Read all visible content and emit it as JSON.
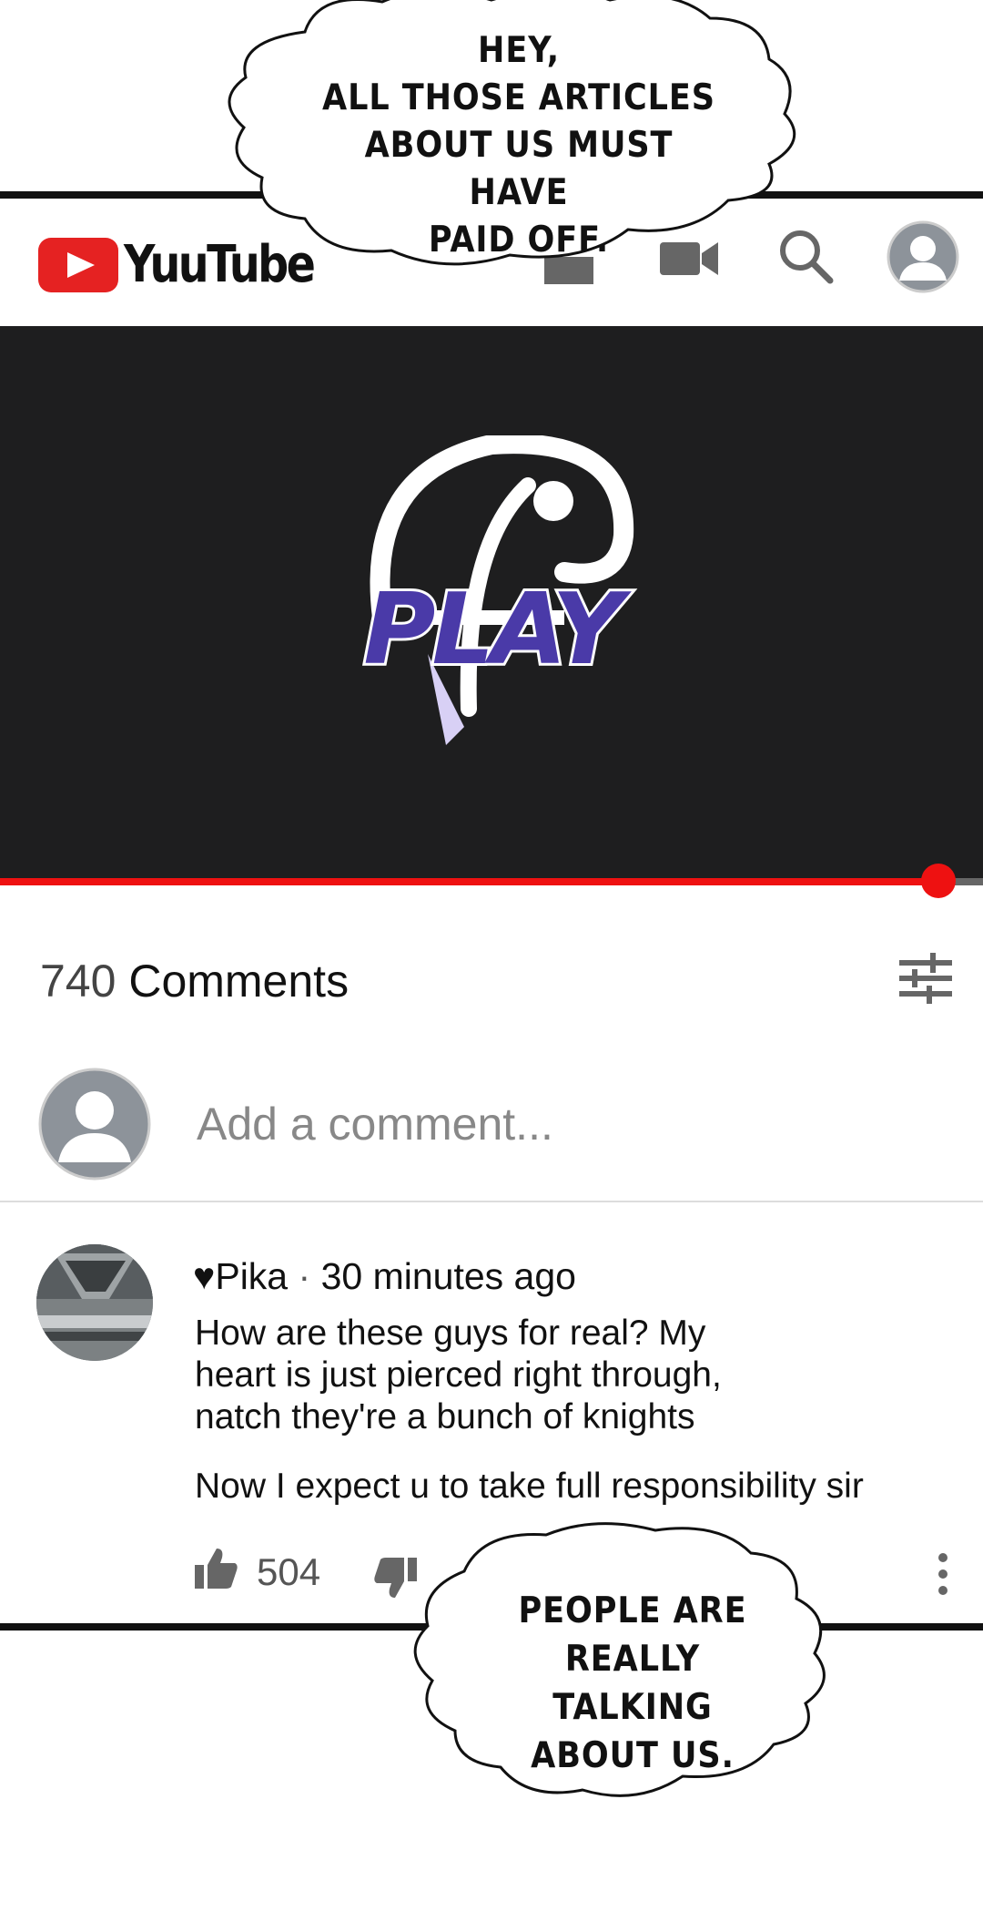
{
  "speech_bubbles": {
    "top": [
      "HEY,",
      "ALL THOSE ARTICLES",
      "ABOUT US MUST HAVE",
      "PAID OFF."
    ],
    "bottom": [
      "PEOPLE ARE",
      "REALLY TALKING",
      "ABOUT US."
    ]
  },
  "header": {
    "app_name": "YuuTube",
    "icons": [
      "youtube-logo-icon",
      "cast-icon",
      "camera-icon",
      "search-icon",
      "account-avatar-icon"
    ]
  },
  "video": {
    "logo_text": "PLAY",
    "progress": 0.955,
    "colors": {
      "background": "#1e1e1f",
      "progress": "#ee1111",
      "logo_purple": "#4a3aa8"
    }
  },
  "comments": {
    "count": "740",
    "label": "Comments",
    "add_placeholder": "Add a comment...",
    "items": [
      {
        "author": "♥Pika",
        "separator": "·",
        "time": "30 minutes ago",
        "lines": [
          "How are these guys for real? My",
          "heart is just pierced right through,",
          "natch they're a bunch of knights"
        ],
        "extra": "Now I expect u to take full responsibility sir",
        "likes": "504"
      }
    ]
  }
}
